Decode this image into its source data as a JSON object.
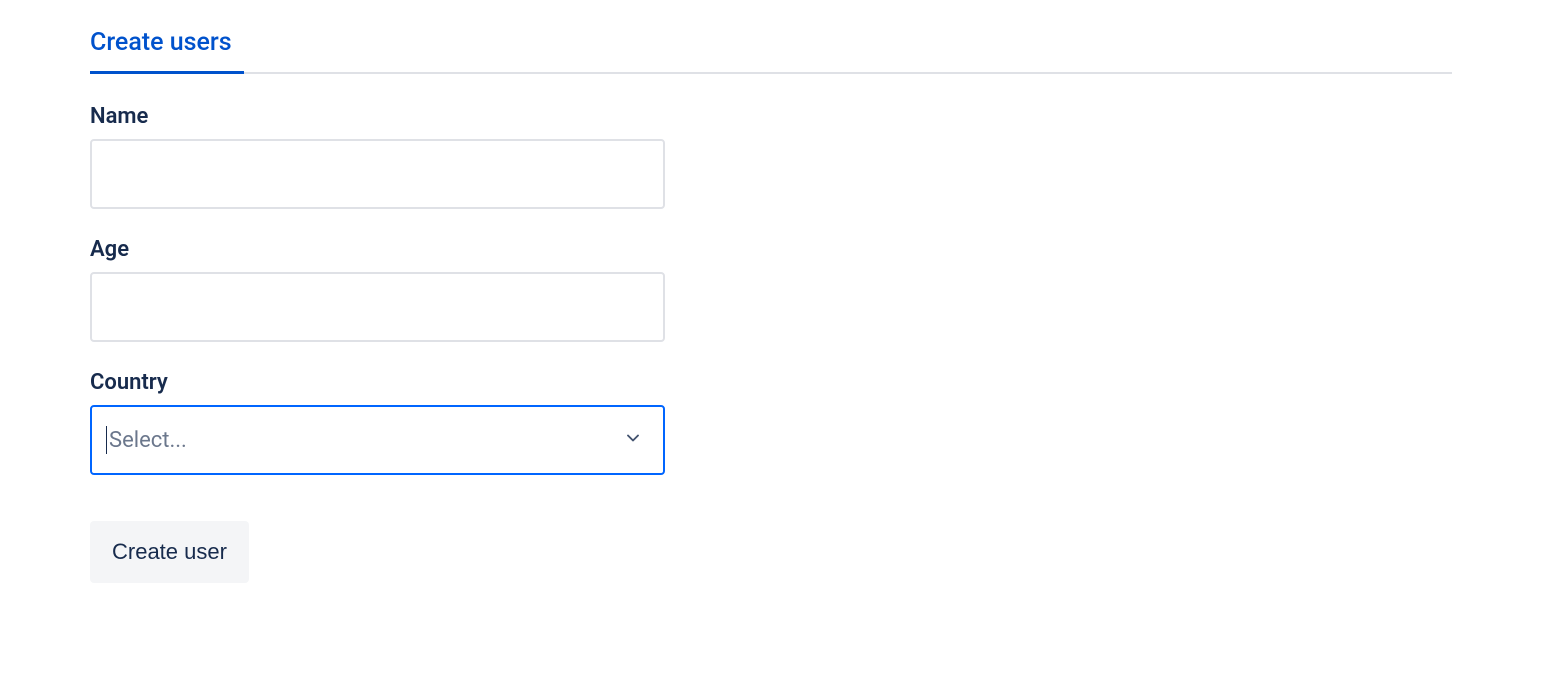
{
  "tabs": {
    "active": {
      "label": "Create users"
    }
  },
  "form": {
    "name": {
      "label": "Name",
      "value": ""
    },
    "age": {
      "label": "Age",
      "value": ""
    },
    "country": {
      "label": "Country",
      "placeholder": "Select...",
      "value": ""
    },
    "submit_label": "Create user"
  }
}
